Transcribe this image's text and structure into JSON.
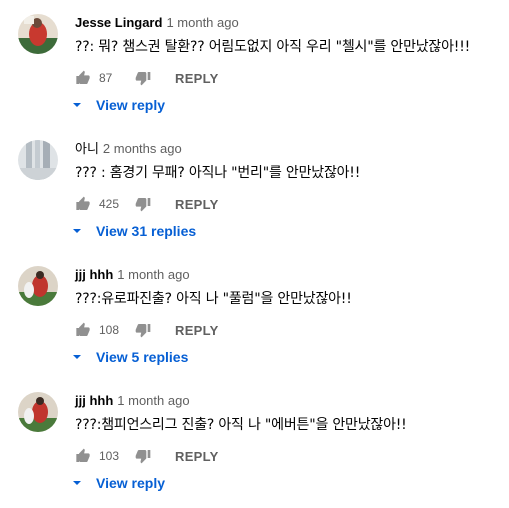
{
  "comments": [
    {
      "author": "Jesse Lingard",
      "time": "1 month ago",
      "text": "??: 뭐? 챔스권 탈환?? 어림도없지 아직 우리 \"첼시\"를 안만났잖아!!!",
      "likes": "87",
      "reply_label": "REPLY",
      "view_replies_label": "View reply",
      "avatar_colors": [
        "#3d6b3a",
        "#c8392f",
        "#e9e1d6"
      ]
    },
    {
      "author": "아니",
      "time": "2 months ago",
      "text": "??? : 홈경기 무패? 아직나 \"번리\"를 안만났잖아!!",
      "likes": "425",
      "reply_label": "REPLY",
      "view_replies_label": "View 31 replies",
      "avatar_colors": [
        "#c9ced3",
        "#9aa3ab",
        "#e7eaec"
      ]
    },
    {
      "author": "jjj hhh",
      "time": "1 month ago",
      "text": "???:유로파진출? 아직 나 \"풀럼\"을 안만났잖아!!",
      "likes": "108",
      "reply_label": "REPLY",
      "view_replies_label": "View 5 replies",
      "avatar_colors": [
        "#4a7a3b",
        "#c0352d",
        "#d9d1c4"
      ]
    },
    {
      "author": "jjj hhh",
      "time": "1 month ago",
      "text": "???:챔피언스리그 진출? 아직 나 \"에버튼\"을 안만났잖아!!",
      "likes": "103",
      "reply_label": "REPLY",
      "view_replies_label": "View reply",
      "avatar_colors": [
        "#4a7a3b",
        "#c0352d",
        "#d9d1c4"
      ]
    }
  ],
  "colors": {
    "link": "#065fd4",
    "secondary": "#606060",
    "icon": "#909090"
  },
  "icons": {
    "like": "thumbs-up-icon",
    "dislike": "thumbs-down-icon",
    "expand": "caret-down-icon"
  }
}
